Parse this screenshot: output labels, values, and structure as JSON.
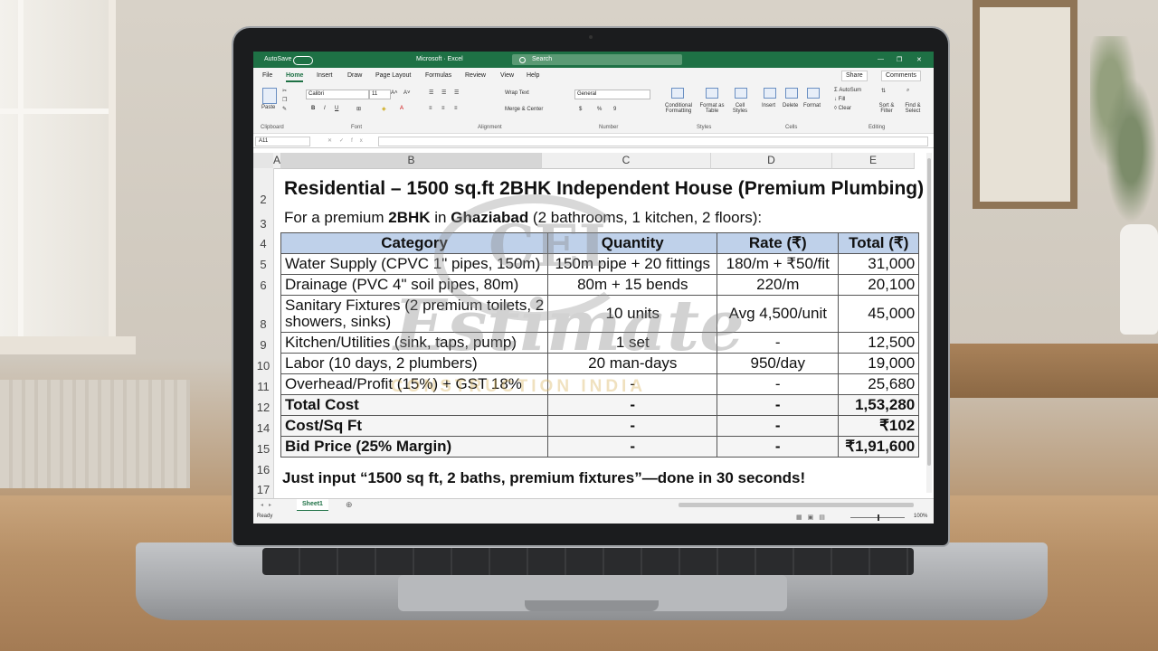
{
  "window": {
    "autosave": "AutoSave",
    "app_title": "Microsoft · Excel",
    "search_placeholder": "Search",
    "controls": [
      "—",
      "❐",
      "✕"
    ]
  },
  "menu": {
    "tabs": [
      "File",
      "Home",
      "Insert",
      "Draw",
      "Page Layout",
      "Formulas",
      "Review",
      "View",
      "Help"
    ],
    "active": "Home",
    "share": "Share",
    "comments": "Comments"
  },
  "ribbon": {
    "paste": "Paste",
    "font_name": "Calibri",
    "font_size": "11",
    "wrap_text": "Wrap Text",
    "merge_center": "Merge & Center",
    "number_format": "General",
    "conditional_formatting": "Conditional Formatting",
    "format_as_table": "Format as Table",
    "cell_styles": "Cell Styles",
    "insert": "Insert",
    "delete": "Delete",
    "format": "Format",
    "autosum": "AutoSum",
    "fill": "Fill",
    "clear": "Clear",
    "sort_filter": "Sort & Filter",
    "find_select": "Find & Select",
    "groups": [
      "Clipboard",
      "Font",
      "Alignment",
      "Number",
      "Styles",
      "Cells",
      "Editing"
    ]
  },
  "formula_bar": {
    "name_box": "A11",
    "fx": "fx",
    "content": ""
  },
  "columns": [
    "A",
    "B",
    "C",
    "D",
    "E"
  ],
  "rows": [
    "2",
    "3",
    "4",
    "5",
    "6",
    "8",
    "9",
    "10",
    "11",
    "12",
    "14",
    "15",
    "16",
    "17"
  ],
  "sheet": {
    "title": "Residential – 1500 sq.ft 2BHK Independent House (Premium Plumbing)",
    "subtitle_prefix": "For a premium ",
    "subtitle_bold1": "2BHK",
    "subtitle_mid": " in ",
    "subtitle_bold2": "Ghaziabad",
    "subtitle_suffix": " (2 bathrooms, 1 kitchen, 2 floors):",
    "headers": [
      "Category",
      "Quantity",
      "Rate (₹)",
      "Total (₹)"
    ],
    "items": [
      {
        "category": "Water Supply (CPVC 1\" pipes, 150m)",
        "quantity": "150m pipe + 20 fittings",
        "rate": "180/m + ₹50/fit",
        "total": "31,000"
      },
      {
        "category": "Drainage (PVC 4\" soil pipes, 80m)",
        "quantity": "80m + 15 bends",
        "rate": "220/m",
        "total": "20,100"
      },
      {
        "category": "Sanitary Fixtures (2 premium toilets, 2",
        "category2": "showers, sinks)",
        "quantity": "10 units",
        "rate": "Avg 4,500/unit",
        "total": "45,000"
      },
      {
        "category": "Kitchen/Utilities (sink, taps, pump)",
        "quantity": "1 set",
        "rate": "-",
        "total": "12,500"
      },
      {
        "category": "Labor (10 days, 2 plumbers)",
        "quantity": "20 man-days",
        "rate": "950/day",
        "total": "19,000"
      },
      {
        "category": "Overhead/Profit (15%) + GST 18%",
        "quantity": "-",
        "rate": "-",
        "total": "25,680"
      }
    ],
    "summary": [
      {
        "label": "Total Cost",
        "quantity": "-",
        "rate": "-",
        "total": "1,53,280"
      },
      {
        "label": "Cost/Sq Ft",
        "quantity": "-",
        "rate": "-",
        "total": "₹102"
      },
      {
        "label": "Bid Price (25% Margin)",
        "quantity": "-",
        "rate": "-",
        "total": "₹1,91,600"
      }
    ],
    "note": "Just input “1500 sq ft, 2 baths, premium fixtures”—done in 30 seconds!"
  },
  "watermark": {
    "logo": "CEI",
    "word": "Estimate",
    "tagline": "CONSTRUCTION INDIA"
  },
  "tabs": {
    "sheet_name": "Sheet1",
    "add": "⊕"
  },
  "status": {
    "ready": "Ready",
    "zoom": "100%"
  },
  "colors": {
    "excel_green": "#1e7145",
    "header_fill": "#bfd1ea"
  }
}
